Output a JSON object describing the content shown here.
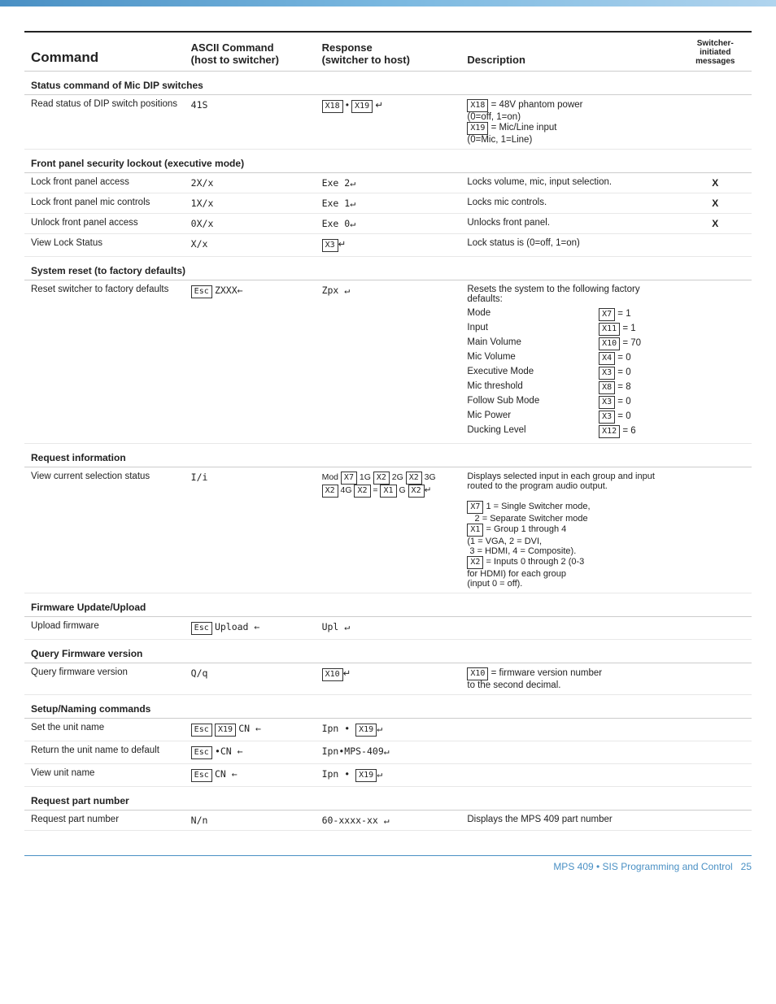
{
  "top_bar": {},
  "header": {
    "col_command": "Command",
    "col_ascii": "ASCII Command\n(host to switcher)",
    "col_ascii_line1": "ASCII Command",
    "col_ascii_line2": "(host to switcher)",
    "col_response": "Response",
    "col_response_line1": "Response",
    "col_response_line2": "(switcher to host)",
    "col_desc": "Description",
    "col_switcher_line1": "Switcher-",
    "col_switcher_line2": "initiated",
    "col_switcher_line3": "messages"
  },
  "sections": [
    {
      "id": "status-mic-dip",
      "title": "Status command of Mic DIP switches",
      "rows": [
        {
          "command": "Read status of DIP switch positions",
          "ascii": "41S",
          "response_html": true,
          "response": "X18 • X19 ↵",
          "description_html": true,
          "description": "X18 = 48V phantom power\n(0=off, 1=on)\nX19 = Mic/Line input\n(0=Mic, 1=Line)",
          "switcher": ""
        }
      ]
    },
    {
      "id": "front-panel-security",
      "title": "Front panel security lockout (executive mode)",
      "rows": [
        {
          "command": "Lock front panel access",
          "ascii": "2X/x",
          "response": "Exe 2↵",
          "description": "Locks volume, mic, input selection.",
          "switcher": "X"
        },
        {
          "command": "Lock front panel mic controls",
          "ascii": "1X/x",
          "response": "Exe 1↵",
          "description": "Locks mic controls.",
          "switcher": "X"
        },
        {
          "command": "Unlock front panel access",
          "ascii": "0X/x",
          "response": "Exe 0↵",
          "description": "Unlocks front panel.",
          "switcher": "X"
        },
        {
          "command": "View Lock Status",
          "ascii": "X/x",
          "response": "X3↵",
          "description": "Lock status is (0=off, 1=on)",
          "switcher": ""
        }
      ]
    },
    {
      "id": "system-reset",
      "title": "System reset (to factory defaults)",
      "rows": [
        {
          "command": "Reset switcher to factory defaults",
          "ascii_esc": true,
          "ascii": "Esc ZXXX←",
          "response": "Zpx ↵",
          "description_list": true,
          "description": "Resets the system to the following factory defaults:",
          "defaults": [
            {
              "label": "Mode",
              "value": "X7 = 1"
            },
            {
              "label": "Input",
              "value": "X11 = 1"
            },
            {
              "label": "Main Volume",
              "value": "X10 = 70"
            },
            {
              "label": "Mic Volume",
              "value": "X4 = 0"
            },
            {
              "label": "Executive Mode",
              "value": "X3 = 0"
            },
            {
              "label": "Mic threshold",
              "value": "X8 = 8"
            },
            {
              "label": "Follow Sub Mode",
              "value": "X3 = 0"
            },
            {
              "label": "Mic Power",
              "value": "X3 = 0"
            },
            {
              "label": "Ducking Level",
              "value": "X12 = 6"
            }
          ],
          "switcher": ""
        }
      ]
    },
    {
      "id": "request-info",
      "title": "Request information",
      "rows": [
        {
          "command": "View current selection status",
          "ascii": "I/i",
          "response_complex": true,
          "response": "Mod X7 1G X2 2G X2 3G X2 4G X2 = X1 G X2↵",
          "description_long": true,
          "description": "Displays selected input in each group and input routed to the program audio output.",
          "desc_items": [
            "X7 1 = Single Switcher mode,\n   2 = Separate Switcher mode",
            "X1 = Group 1 through 4\n(1 = VGA, 2 = DVI,\n 3 = HDMI, 4 = Composite).",
            "X2 = Inputs 0 through 2 (0-3\nfor HDMI) for each group\n(input 0 = off)."
          ],
          "switcher": ""
        }
      ]
    },
    {
      "id": "firmware-update",
      "title": "Firmware Update/Upload",
      "rows": [
        {
          "command": "Upload firmware",
          "ascii_esc": true,
          "ascii": "Esc Upload ←",
          "response": "Upl ↵",
          "description": "",
          "switcher": ""
        }
      ]
    },
    {
      "id": "query-firmware",
      "title": "Query Firmware version",
      "rows": [
        {
          "command": "Query firmware version",
          "ascii": "Q/q",
          "response": "X10↵",
          "description": "X10 = firmware version number\nto the second decimal.",
          "switcher": ""
        }
      ]
    },
    {
      "id": "setup-naming",
      "title": "Setup/Naming commands",
      "rows": [
        {
          "command": "Set the unit name",
          "ascii_esc": true,
          "ascii": "Esc X19 CN ←",
          "response": "Ipn • X19↵",
          "description": "",
          "switcher": ""
        },
        {
          "command": "Return the unit name to default",
          "ascii_esc": true,
          "ascii": "Esc •CN ←",
          "response": "Ipn•MPS-409↵",
          "description": "",
          "switcher": ""
        },
        {
          "command": "View unit name",
          "ascii_esc": true,
          "ascii": "Esc CN ←",
          "response": "Ipn • X19↵",
          "description": "",
          "switcher": ""
        }
      ]
    },
    {
      "id": "request-part",
      "title": "Request part number",
      "rows": [
        {
          "command": "Request part number",
          "ascii": "N/n",
          "response": "60-xxxx-xx ↵",
          "description": "Displays the MPS 409 part number",
          "switcher": ""
        }
      ]
    }
  ],
  "footer": {
    "text": "MPS 409 • SIS Programming and Control",
    "page": "25"
  }
}
